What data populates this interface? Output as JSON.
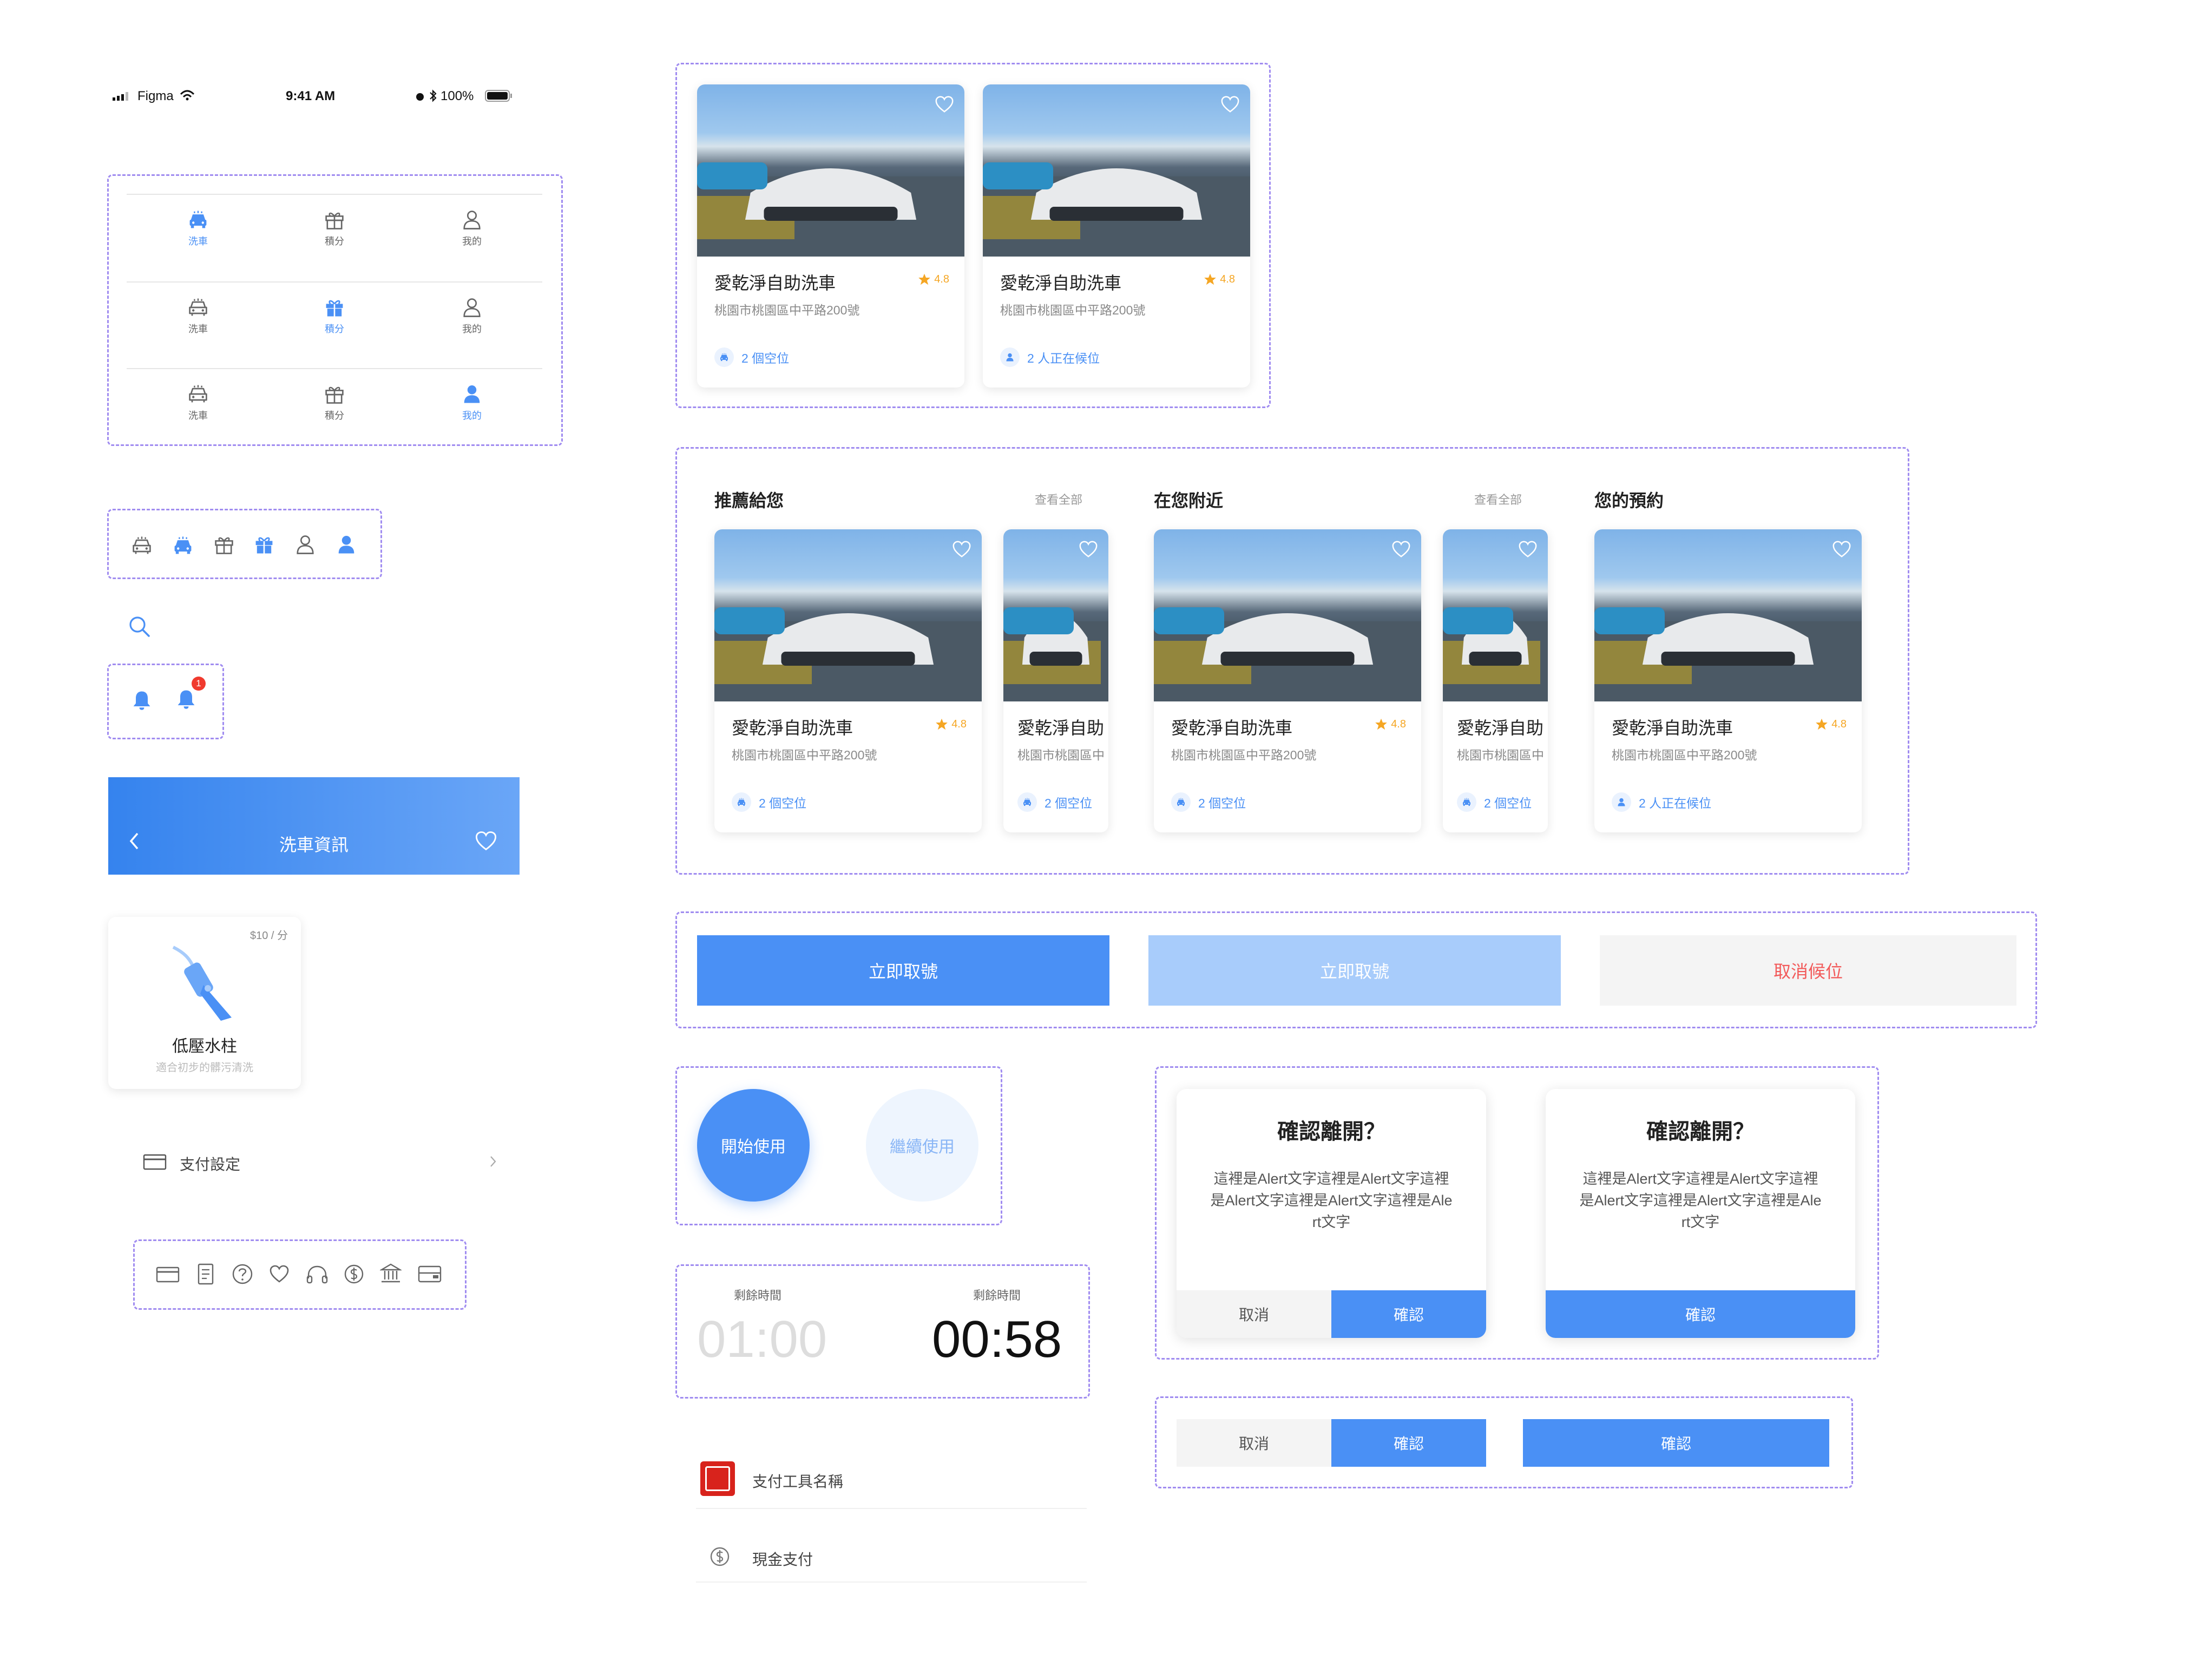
{
  "status_bar": {
    "carrier": "Figma",
    "time": "9:41 AM",
    "battery": "100%"
  },
  "tab_bar": {
    "rows": [
      [
        {
          "label": "洗車",
          "icon": "car-icon",
          "active": true
        },
        {
          "label": "積分",
          "icon": "gift-icon",
          "active": false
        },
        {
          "label": "我的",
          "icon": "user-icon",
          "active": false
        }
      ],
      [
        {
          "label": "洗車",
          "icon": "car-icon",
          "active": false
        },
        {
          "label": "積分",
          "icon": "gift-icon",
          "active": true
        },
        {
          "label": "我的",
          "icon": "user-icon",
          "active": false
        }
      ],
      [
        {
          "label": "洗車",
          "icon": "car-icon",
          "active": false
        },
        {
          "label": "積分",
          "icon": "gift-icon",
          "active": false
        },
        {
          "label": "我的",
          "icon": "user-icon",
          "active": true
        }
      ]
    ]
  },
  "icon_set_nav": [
    "car-outline-icon",
    "car-filled-icon",
    "gift-outline-icon",
    "gift-filled-icon",
    "user-outline-icon",
    "user-filled-icon"
  ],
  "search_icon": "search-icon",
  "bell": {
    "badge": "1"
  },
  "header": {
    "title": "洗車資訊"
  },
  "service": {
    "price": "$10 / 分",
    "name": "低壓水柱",
    "desc": "適合初步的髒污清洗"
  },
  "payment_setting": {
    "label": "支付設定"
  },
  "icon_set_misc": [
    "card-icon",
    "receipt-icon",
    "help-icon",
    "heart-icon",
    "headset-icon",
    "dollar-icon",
    "bank-icon",
    "wallet-icon"
  ],
  "top_cards": [
    {
      "title": "愛乾淨自助洗車",
      "rating": "4.8",
      "address": "桃園市桃園區中平路200號",
      "info": "2 個空位",
      "info_icon": "car-icon"
    },
    {
      "title": "愛乾淨自助洗車",
      "rating": "4.8",
      "address": "桃園市桃園區中平路200號",
      "info": "2 人正在候位",
      "info_icon": "user-icon"
    }
  ],
  "sections": [
    {
      "title": "推薦給您",
      "view_all": "查看全部",
      "cards": [
        {
          "title": "愛乾淨自助洗車",
          "rating": "4.8",
          "address": "桃園市桃園區中平路200號",
          "info": "2 個空位"
        },
        {
          "title": "愛乾淨自助",
          "address": "桃園市桃園區中",
          "info": "2 個空位"
        }
      ]
    },
    {
      "title": "在您附近",
      "view_all": "查看全部",
      "cards": [
        {
          "title": "愛乾淨自助洗車",
          "rating": "4.8",
          "address": "桃園市桃園區中平路200號",
          "info": "2 個空位"
        },
        {
          "title": "愛乾淨自助",
          "address": "桃園市桃園區中",
          "info": "2 個空位"
        }
      ]
    },
    {
      "title": "您的預約",
      "cards": [
        {
          "title": "愛乾淨自助洗車",
          "rating": "4.8",
          "address": "桃園市桃園區中平路200號",
          "info": "2 人正在候位"
        }
      ]
    }
  ],
  "buttons": {
    "primary": "立即取號",
    "disabled": "立即取號",
    "cancel_queue": "取消候位"
  },
  "round_buttons": {
    "start": "開始使用",
    "continue": "繼續使用"
  },
  "timers": [
    {
      "label": "剩餘時間",
      "value": "01:00"
    },
    {
      "label": "剩餘時間",
      "value": "00:58"
    }
  ],
  "payment_tools": [
    {
      "label": "支付工具名稱",
      "icon": "jkopay-logo"
    },
    {
      "label": "現金支付",
      "icon": "dollar-icon"
    }
  ],
  "dialogs": [
    {
      "title": "確認離開？",
      "body": "這裡是Alert文字這裡是Alert文字這裡是Alert文字這裡是Alert文字這裡是Alert文字",
      "cancel": "取消",
      "confirm": "確認"
    },
    {
      "title": "確認離開？",
      "body": "這裡是Alert文字這裡是Alert文字這裡是Alert文字這裡是Alert文字這裡是Alert文字",
      "confirm": "確認"
    }
  ],
  "dialog_buttons": {
    "cancel": "取消",
    "confirm": "確認",
    "confirm_single": "確認"
  },
  "colors": {
    "primary": "#4a90f5",
    "disabled": "#a8ccfb",
    "danger": "#f25a5a",
    "warning": "#f5a623",
    "border_dash": "#a08cf0"
  }
}
